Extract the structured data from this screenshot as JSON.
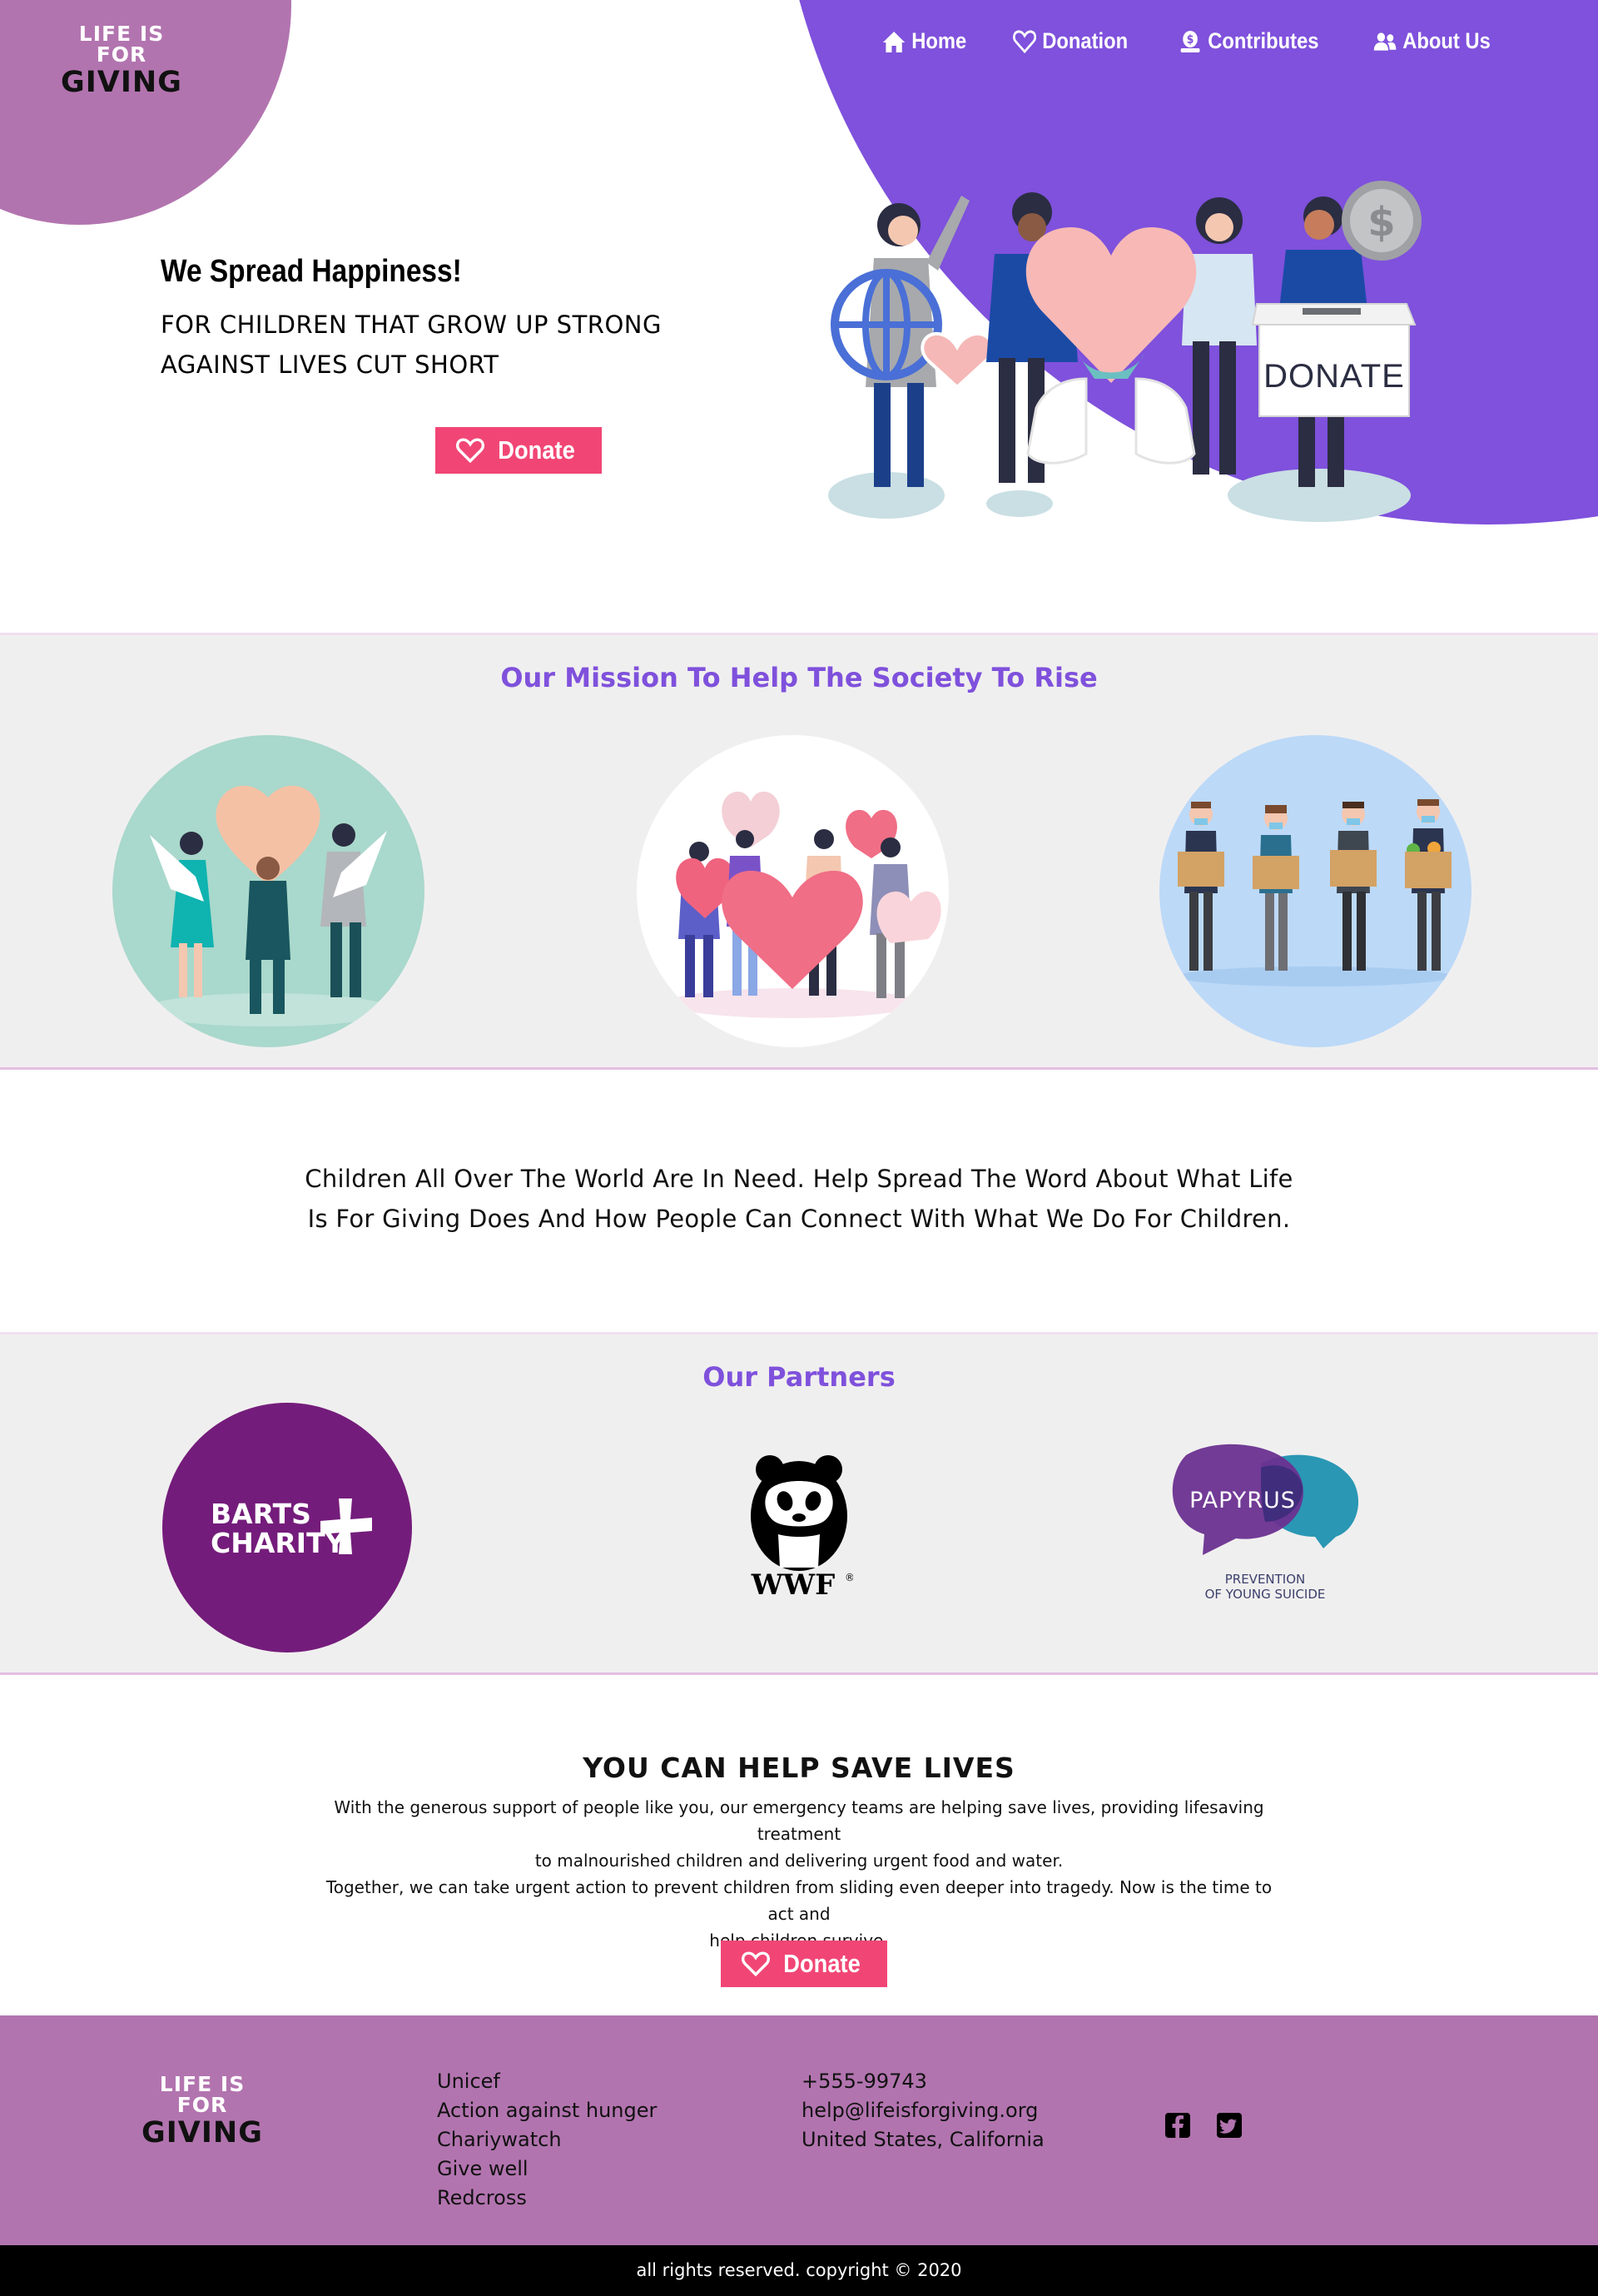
{
  "brand": {
    "line1": "LIFE IS FOR",
    "line2": "GIVING"
  },
  "nav": {
    "items": [
      {
        "label": "Home",
        "icon": "home-icon"
      },
      {
        "label": "Donation",
        "icon": "heart-icon"
      },
      {
        "label": "Contributes",
        "icon": "dollar-hand-icon"
      },
      {
        "label": "About Us",
        "icon": "users-icon"
      }
    ]
  },
  "hero": {
    "title": "We Spread Happiness!",
    "subtitle_line1": "FOR CHILDREN THAT GROW UP STRONG",
    "subtitle_line2": "AGAINST LIVES CUT SHORT",
    "donate_label": "Donate",
    "illustration_box_label": "DONATE"
  },
  "mission": {
    "title": "Our Mission To Help The Society To Rise"
  },
  "statement": {
    "line1": "Children All Over The World Are In Need. Help Spread The Word About What Life",
    "line2": "Is For Giving Does And How People Can Connect With What We Do For Children."
  },
  "partners": {
    "title": "Our Partners",
    "barts": {
      "line1": "BARTS",
      "line2": "CHARITY"
    },
    "wwf": {
      "name": "WWF",
      "mark": "®"
    },
    "papyrus": {
      "name": "PAPYRUS",
      "line1": "PREVENTION",
      "line2": "OF YOUNG SUICIDE"
    }
  },
  "help": {
    "title": "YOU CAN HELP SAVE LIVES",
    "p1_line1": "With the generous support of people like you, our emergency teams are helping save lives, providing lifesaving treatment",
    "p1_line2": "to malnourished children and delivering urgent food and water.",
    "p2_line1": "Together, we can take urgent action to prevent children from sliding even deeper into tragedy. Now is the time to act and",
    "p2_line2": "help children survive.",
    "donate_label": "Donate"
  },
  "footer": {
    "links": [
      "Unicef",
      "Action against hunger",
      "Chariywatch",
      "Give well",
      "Redcross"
    ],
    "contact": {
      "phone": "+555-99743",
      "email": "help@lifeisforgiving.org",
      "location": "United States, California"
    },
    "social": [
      "facebook-icon",
      "twitter-icon"
    ],
    "copyright": "all rights reserved. copyright © 2020"
  },
  "colors": {
    "purple": "#7f51dc",
    "mauve": "#b274af",
    "donate_pink": "#f14675",
    "band_grey": "#f0efef"
  }
}
